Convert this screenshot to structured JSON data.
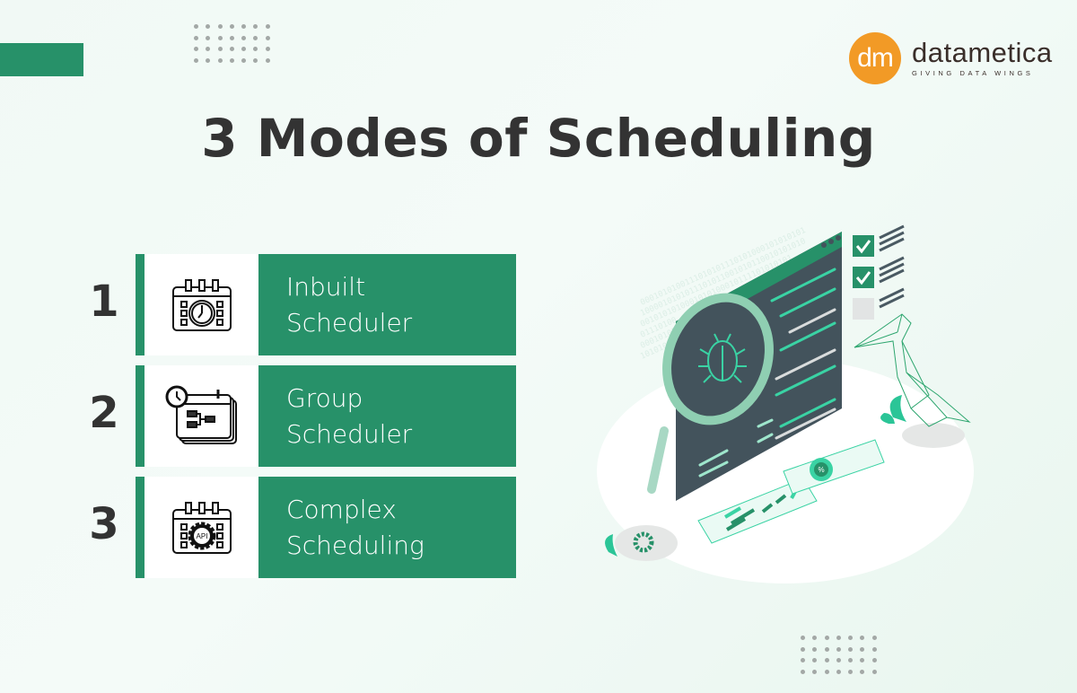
{
  "brand": {
    "logo_mark": "dm",
    "name": "datametica",
    "tagline": "GIVING DATA WINGS",
    "colors": {
      "primary_green": "#279169",
      "logo_orange": "#f29a26",
      "text_dark": "#333333"
    }
  },
  "title": "3 Modes of Scheduling",
  "modes": [
    {
      "number": "1",
      "line1": "Inbuilt",
      "line2": "Scheduler",
      "icon": "calendar-clock-icon"
    },
    {
      "number": "2",
      "line1": "Group",
      "line2": "Scheduler",
      "icon": "calendar-group-clock-icon"
    },
    {
      "number": "3",
      "line1": "Complex",
      "line2": "Scheduling",
      "icon": "calendar-api-gear-icon"
    }
  ],
  "illustration": {
    "description": "Debugging illustration: code window with magnifying glass over bug, checklist, pelican, report cards",
    "percent_symbol": "%"
  }
}
